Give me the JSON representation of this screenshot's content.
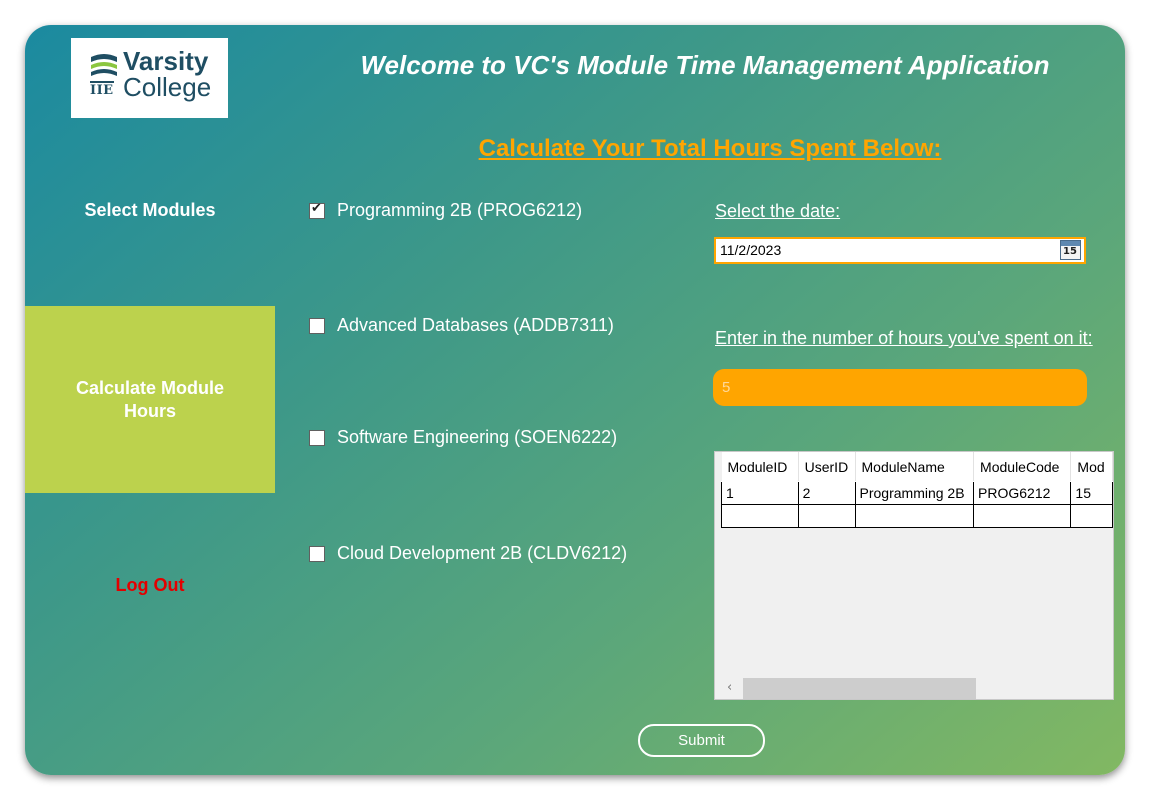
{
  "logo": {
    "line1": "Varsity",
    "line2": "College",
    "mark": "IIE"
  },
  "header": {
    "title": "Welcome to VC's Module Time Management Application",
    "subtitle": "Calculate Your Total Hours Spent Below:"
  },
  "nav": {
    "select_modules": "Select Modules",
    "calculate_hours": "Calculate Module Hours",
    "log_out": "Log Out"
  },
  "modules": [
    {
      "label": "Programming 2B (PROG6212)",
      "checked": true
    },
    {
      "label": "Advanced Databases (ADDB7311)",
      "checked": false
    },
    {
      "label": "Software Engineering (SOEN6222)",
      "checked": false
    },
    {
      "label": "Cloud Development 2B (CLDV6212)",
      "checked": false
    }
  ],
  "date": {
    "label": "Select the date:",
    "value": "11/2/2023",
    "calendar_day": "15",
    "calendar_icon": "calendar-icon"
  },
  "hours": {
    "label": "Enter in the number of hours you've spent on it:",
    "placeholder": "5"
  },
  "grid": {
    "columns": [
      "ModuleID",
      "UserID",
      "ModuleName",
      "ModuleCode",
      "Mod"
    ],
    "rows": [
      [
        "1",
        "2",
        "Programming 2B",
        "PROG6212",
        "15"
      ]
    ]
  },
  "submit_label": "Submit",
  "colors": {
    "accent": "#ffa500",
    "nav_active": "#bcd24d",
    "logout": "#e30000"
  }
}
